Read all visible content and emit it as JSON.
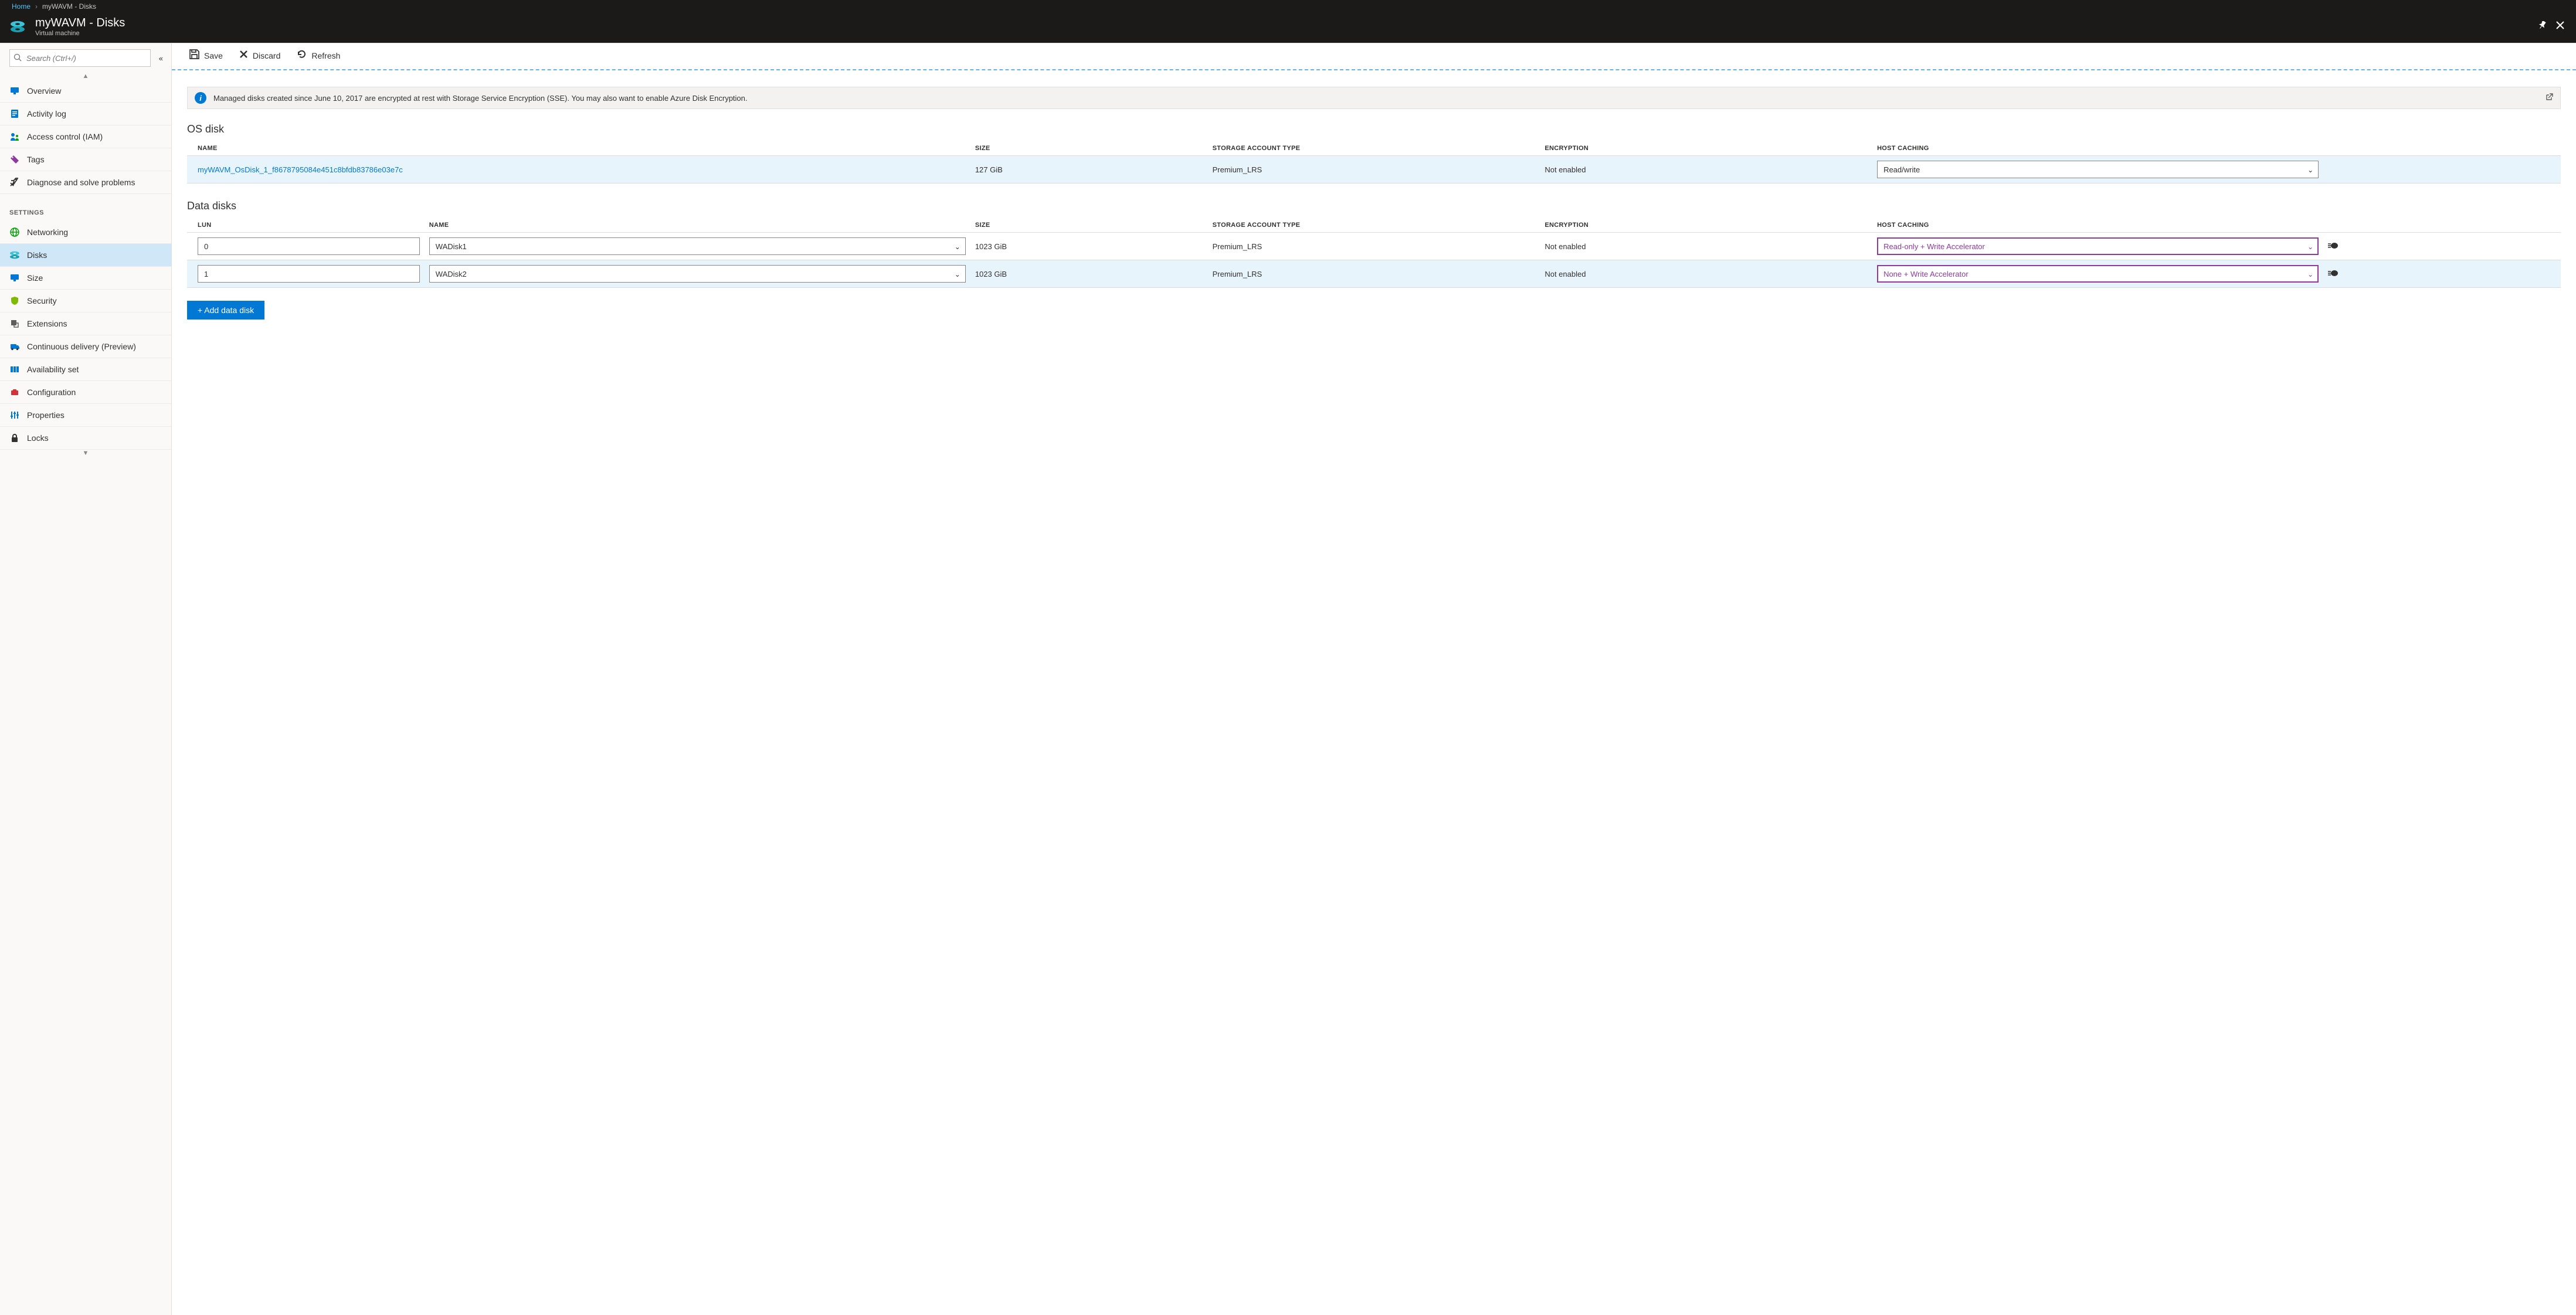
{
  "breadcrumb": {
    "home": "Home",
    "sep": "›",
    "current": "myWAVM - Disks"
  },
  "header": {
    "title": "myWAVM - Disks",
    "subtitle": "Virtual machine"
  },
  "search": {
    "placeholder": "Search (Ctrl+/)"
  },
  "sidebar": {
    "section_top": [
      {
        "icon": "overview-icon",
        "label": "Overview",
        "color": "#0078d4"
      },
      {
        "icon": "activity-log-icon",
        "label": "Activity log",
        "color": "#0078d4"
      },
      {
        "icon": "access-control-icon",
        "label": "Access control (IAM)",
        "color": "#0078d4"
      },
      {
        "icon": "tags-icon",
        "label": "Tags",
        "color": "#8e3a9d"
      },
      {
        "icon": "diagnose-icon",
        "label": "Diagnose and solve problems",
        "color": "#323130"
      }
    ],
    "section_settings_title": "SETTINGS",
    "section_settings": [
      {
        "icon": "networking-icon",
        "label": "Networking",
        "color": "#00a300",
        "selected": false
      },
      {
        "icon": "disks-icon",
        "label": "Disks",
        "color": "#00a300",
        "selected": true
      },
      {
        "icon": "size-icon",
        "label": "Size",
        "color": "#0078d4",
        "selected": false
      },
      {
        "icon": "security-icon",
        "label": "Security",
        "color": "#7fba00",
        "selected": false
      },
      {
        "icon": "extensions-icon",
        "label": "Extensions",
        "color": "#605e5c",
        "selected": false
      },
      {
        "icon": "continuous-delivery-icon",
        "label": "Continuous delivery (Preview)",
        "color": "#0078d4",
        "selected": false
      },
      {
        "icon": "availability-set-icon",
        "label": "Availability set",
        "color": "#0078d4",
        "selected": false
      },
      {
        "icon": "configuration-icon",
        "label": "Configuration",
        "color": "#d13438",
        "selected": false
      },
      {
        "icon": "properties-icon",
        "label": "Properties",
        "color": "#0078d4",
        "selected": false
      },
      {
        "icon": "locks-icon",
        "label": "Locks",
        "color": "#323130",
        "selected": false
      }
    ]
  },
  "toolbar": {
    "save": "Save",
    "discard": "Discard",
    "refresh": "Refresh"
  },
  "banner": {
    "text": "Managed disks created since June 10, 2017 are encrypted at rest with Storage Service Encryption (SSE). You may also want to enable Azure Disk Encryption."
  },
  "sections": {
    "os_disk": "OS disk",
    "data_disks": "Data disks"
  },
  "columns": {
    "name": "NAME",
    "size": "SIZE",
    "storage": "STORAGE ACCOUNT TYPE",
    "encryption": "ENCRYPTION",
    "caching": "HOST CACHING",
    "lun": "LUN"
  },
  "os_disk": {
    "name": "myWAVM_OsDisk_1_f8678795084e451c8bfdb83786e03e7c",
    "size": "127 GiB",
    "storage": "Premium_LRS",
    "encryption": "Not enabled",
    "caching": "Read/write"
  },
  "data_disks": [
    {
      "lun": "0",
      "name": "WADisk1",
      "size": "1023 GiB",
      "storage": "Premium_LRS",
      "encryption": "Not enabled",
      "caching": "Read-only + Write Accelerator"
    },
    {
      "lun": "1",
      "name": "WADisk2",
      "size": "1023 GiB",
      "storage": "Premium_LRS",
      "encryption": "Not enabled",
      "caching": "None + Write Accelerator"
    }
  ],
  "add_button": "+ Add data disk"
}
